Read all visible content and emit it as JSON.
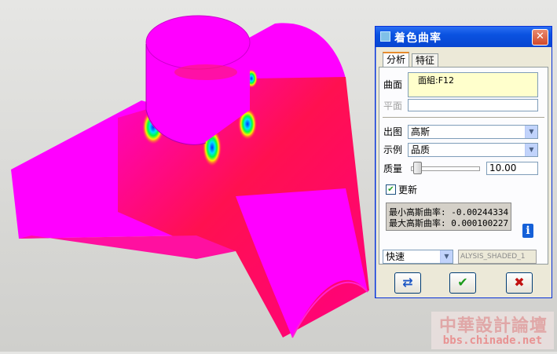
{
  "dialog": {
    "title": "着色曲率",
    "close_label": "✕",
    "tabs": [
      {
        "label": "分析"
      },
      {
        "label": "特征"
      }
    ],
    "surface": {
      "label": "曲面",
      "value": "面組:F12"
    },
    "plane": {
      "label": "平面",
      "value": ""
    },
    "output": {
      "label": "出图",
      "value": "高斯"
    },
    "example": {
      "label": "示例",
      "value": "品质"
    },
    "quality": {
      "label": "质量",
      "value": "10.00",
      "slider_level": 0.05
    },
    "update": {
      "label": "更新",
      "checked": true
    },
    "info_lines": [
      "最小高斯曲率: -0.00244334",
      "最大高斯曲率: 0.000100227"
    ],
    "info_icon": "info-icon",
    "mode": {
      "value": "快速"
    },
    "result_name": "ALYSIS_SHADED_1",
    "buttons": {
      "repaint_icon": "repaint-icon",
      "ok_icon": "check-icon",
      "cancel_icon": "x-icon"
    }
  },
  "watermark": {
    "main": "中華設計論壇",
    "sub": "bbs.chinade.net"
  },
  "colors": {
    "surface_magenta": "#ff00ff",
    "surface_red": "#ff1a4d",
    "dialog_bg": "#ece9d8",
    "titlebar_blue": "#0a52e0"
  }
}
